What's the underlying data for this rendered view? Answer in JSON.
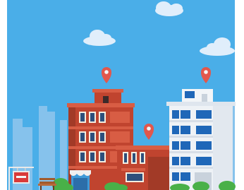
{
  "scene": {
    "elements": [
      "sky",
      "cloud",
      "cloud",
      "cloud",
      "city-silhouette",
      "brick-apartment-building",
      "brick-low-building",
      "white-office-building",
      "location-pin-icon",
      "location-pin-icon",
      "location-pin-icon",
      "bush",
      "bush",
      "bench",
      "for-sale-sign"
    ]
  },
  "colors": {
    "sky": "#4aaee8",
    "cloud": "#dfeffc",
    "silhouette": "#90c8ee",
    "brick_main": "#c0442f",
    "brick_dark": "#9e3424",
    "brick_light": "#d85d44",
    "office": "#eef2f6",
    "office_window": "#1f67b8",
    "pin": "#e2574c",
    "bush": "#49b048"
  }
}
